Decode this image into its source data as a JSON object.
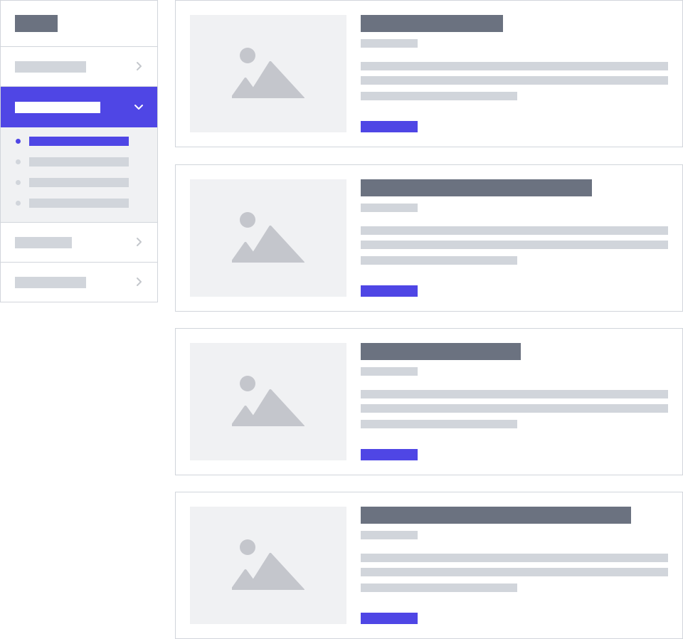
{
  "colors": {
    "accent": "#4f46e5",
    "dark_placeholder": "#6b7280",
    "light_placeholder": "#d1d5db",
    "panel_background": "#f0f1f3",
    "border": "#d1d5db"
  },
  "sidebar": {
    "brand": "",
    "items": [
      {
        "label": "",
        "icon": "chevron-right-icon",
        "expanded": false
      },
      {
        "label": "",
        "icon": "chevron-down-icon",
        "expanded": true,
        "active": true,
        "subitems": [
          {
            "label": "",
            "active": true
          },
          {
            "label": "",
            "active": false
          },
          {
            "label": "",
            "active": false
          },
          {
            "label": "",
            "active": false
          }
        ]
      },
      {
        "label": "",
        "icon": "chevron-right-icon",
        "expanded": false
      },
      {
        "label": "",
        "icon": "chevron-right-icon",
        "expanded": false
      }
    ]
  },
  "cards": [
    {
      "title": "",
      "meta": "",
      "body": "",
      "action": "",
      "image_icon": "image-placeholder-icon"
    },
    {
      "title": "",
      "meta": "",
      "body": "",
      "action": "",
      "image_icon": "image-placeholder-icon"
    },
    {
      "title": "",
      "meta": "",
      "body": "",
      "action": "",
      "image_icon": "image-placeholder-icon"
    },
    {
      "title": "",
      "meta": "",
      "body": "",
      "action": "",
      "image_icon": "image-placeholder-icon"
    }
  ]
}
